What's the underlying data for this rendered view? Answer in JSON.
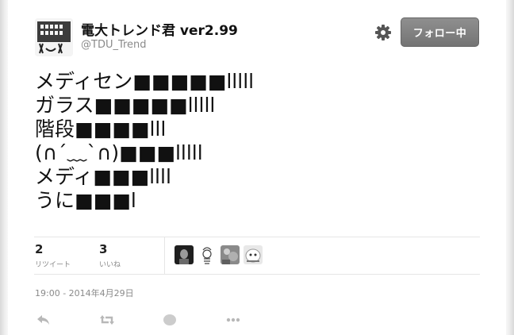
{
  "user": {
    "name": "電大トレンド君 ver2.99",
    "handle": "@TDU_Trend"
  },
  "follow_button": {
    "label": "フォロー中"
  },
  "tweet": {
    "lines": [
      "メディセン■■■■■lllll",
      "ガラス■■■■■lllll",
      "階段■■■■lll",
      "(∩´﹏`∩)■■■lllll",
      "メディ■■■llll",
      "うに■■■l"
    ]
  },
  "stats": {
    "retweets": {
      "count": "2",
      "label": "リツイート"
    },
    "likes": {
      "count": "3",
      "label": "いいね"
    }
  },
  "timestamp": "19:00 - 2014年4月29日",
  "icons": [
    "settings-gear-icon",
    "reply-icon",
    "retweet-icon",
    "like-icon",
    "more-icon"
  ],
  "colors": {
    "follow_button": "#7f7f7f",
    "muted_text": "#8a8a8a",
    "divider": "#e6e6e6"
  }
}
